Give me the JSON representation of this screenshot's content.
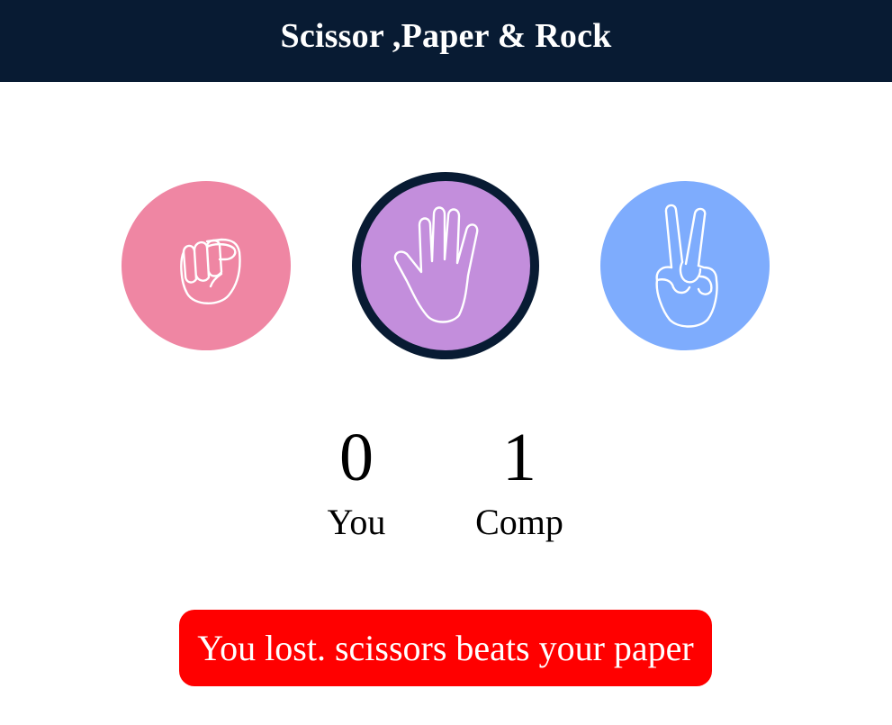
{
  "header": {
    "title": "Scissor ,Paper & Rock"
  },
  "choices": [
    {
      "id": "rock",
      "icon": "fist-icon",
      "color": "#ef86a3",
      "selected": false
    },
    {
      "id": "paper",
      "icon": "open-hand-icon",
      "color": "#c38edc",
      "selected": true
    },
    {
      "id": "scissors",
      "icon": "peace-hand-icon",
      "color": "#7eacfd",
      "selected": false
    }
  ],
  "score": {
    "user_value": "0",
    "user_label": "You",
    "comp_value": "1",
    "comp_label": "Comp"
  },
  "message": {
    "text": "You lost. scissors beats your paper",
    "color": "#ff0000"
  },
  "theme": {
    "header_bg": "#081b33",
    "selected_border": "#081b33"
  }
}
